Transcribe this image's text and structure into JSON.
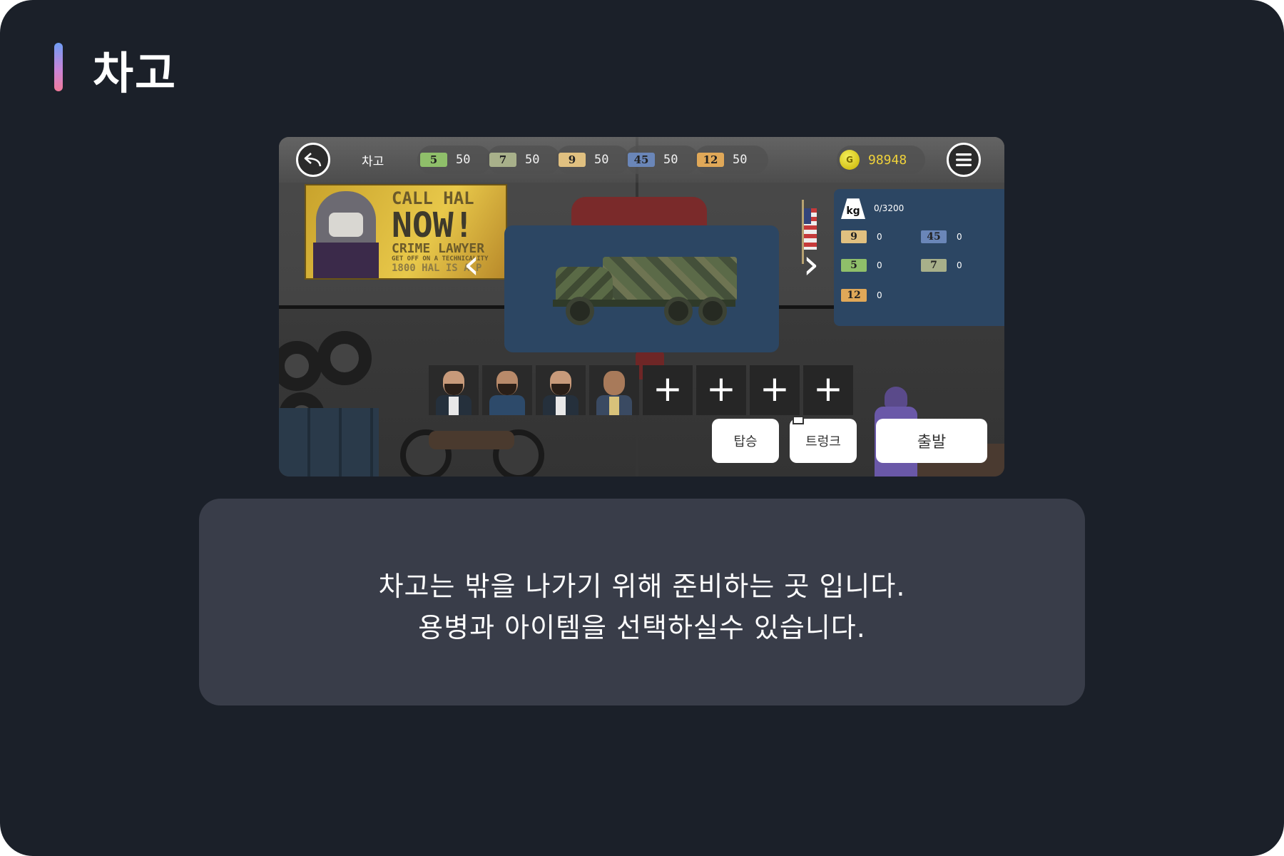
{
  "page": {
    "title": "차고"
  },
  "game": {
    "hud": {
      "back_icon": "undo-arrow-icon",
      "title": "차고",
      "menu_icon": "hamburger-menu-icon",
      "resources": [
        {
          "label": "5",
          "count": "50",
          "color": "#8fbf6a"
        },
        {
          "label": "7",
          "count": "50",
          "color": "#a8b08a"
        },
        {
          "label": "9",
          "count": "50",
          "color": "#e0c080"
        },
        {
          "label": "45",
          "count": "50",
          "color": "#6a86b8"
        },
        {
          "label": "12",
          "count": "50",
          "color": "#e0a858"
        }
      ],
      "coin": {
        "icon_text": "G",
        "count": "98948"
      }
    },
    "poster": {
      "line1": "CALL HAL",
      "line2": "NOW!",
      "line3": "CRIME LAWYER",
      "line4": "GET OFF ON A TECHNICALITY",
      "line5": "1800 HAL IS A P"
    },
    "weight": {
      "icon_text": "kg",
      "value": "0/3200"
    },
    "inventory": [
      {
        "label": "9",
        "count": "0",
        "color": "#e0c080"
      },
      {
        "label": "45",
        "count": "0",
        "color": "#6a86b8"
      },
      {
        "label": "5",
        "count": "0",
        "color": "#8fbf6a"
      },
      {
        "label": "7",
        "count": "0",
        "color": "#a8b08a"
      },
      {
        "label": "12",
        "count": "0",
        "color": "#e0a858"
      }
    ],
    "crew_slots": [
      "+",
      "+",
      "+",
      "+"
    ],
    "buttons": {
      "board": "탑승",
      "trunk": "트렁크",
      "depart": "출발"
    }
  },
  "description": {
    "line1": "차고는 밖을 나가기 위해 준비하는 곳 입니다.",
    "line2": "용병과 아이템을 선택하실수 있습니다."
  }
}
